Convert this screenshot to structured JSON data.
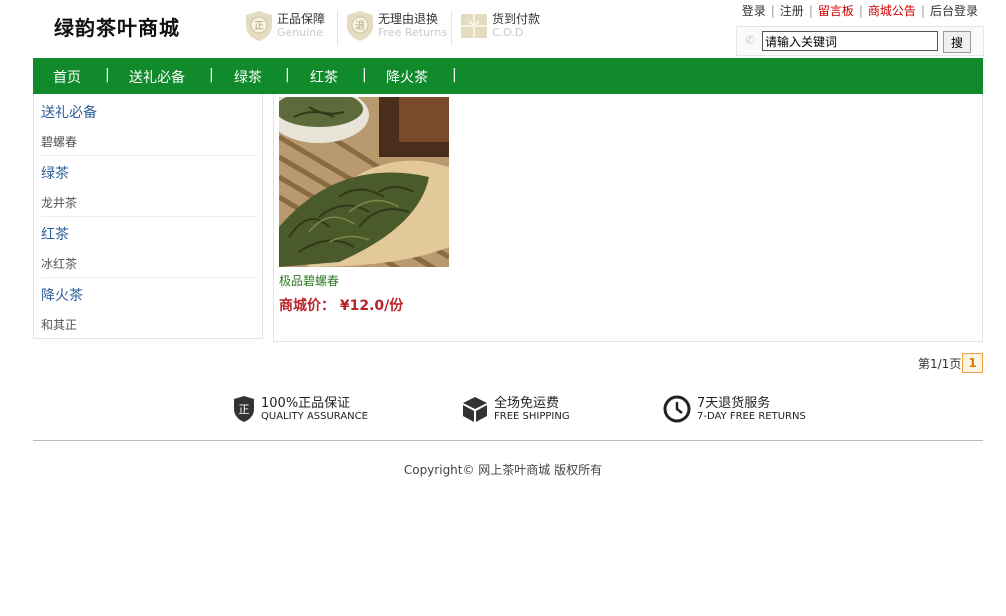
{
  "site": {
    "logo": "绿韵茶叶商城"
  },
  "badges": [
    {
      "cn": "正品保障",
      "en": "Genuine",
      "icon": "genuine-shield-icon"
    },
    {
      "cn": "无理由退换",
      "en": "Free Returns",
      "icon": "return-shield-icon"
    },
    {
      "cn": "货到付款",
      "en": "C.O.D",
      "icon": "cod-package-icon"
    }
  ],
  "toplinks": {
    "login": "登录",
    "register": "注册",
    "guestbook": "留言板",
    "announcement": "商城公告",
    "admin": "后台登录",
    "sep": "|"
  },
  "search": {
    "placeholder": "请输入关键词",
    "value": "请输入关键词",
    "button": "搜"
  },
  "nav": {
    "items": [
      "首页",
      "送礼必备",
      "绿茶",
      "红茶",
      "降火茶"
    ],
    "sep": "|"
  },
  "sidebar": {
    "categories": [
      {
        "name": "送礼必备",
        "sub": "碧螺春"
      },
      {
        "name": "绿茶",
        "sub": "龙井茶"
      },
      {
        "name": "红茶",
        "sub": "冰红茶"
      },
      {
        "name": "降火茶",
        "sub": "和其正"
      }
    ]
  },
  "products": [
    {
      "name": "极品碧螺春",
      "price": "商城价： ¥12.0/份"
    }
  ],
  "pagination": {
    "info": "第1/1页",
    "current": "1"
  },
  "features": [
    {
      "cn": "100%正品保证",
      "en": "QUALITY ASSURANCE",
      "icon": "genuine-shield-icon"
    },
    {
      "cn": "全场免运费",
      "en": "FREE SHIPPING",
      "icon": "box-icon"
    },
    {
      "cn": "7天退货服务",
      "en": "7-DAY FREE RETURNS",
      "icon": "clock-icon"
    }
  ],
  "footer": {
    "copyright": "Copyright© 网上茶叶商城 版权所有"
  },
  "colors": {
    "nav_bg": "#108a2b",
    "price": "#b8242a",
    "product_name": "#2c7a22",
    "category": "#2d5f9a"
  }
}
